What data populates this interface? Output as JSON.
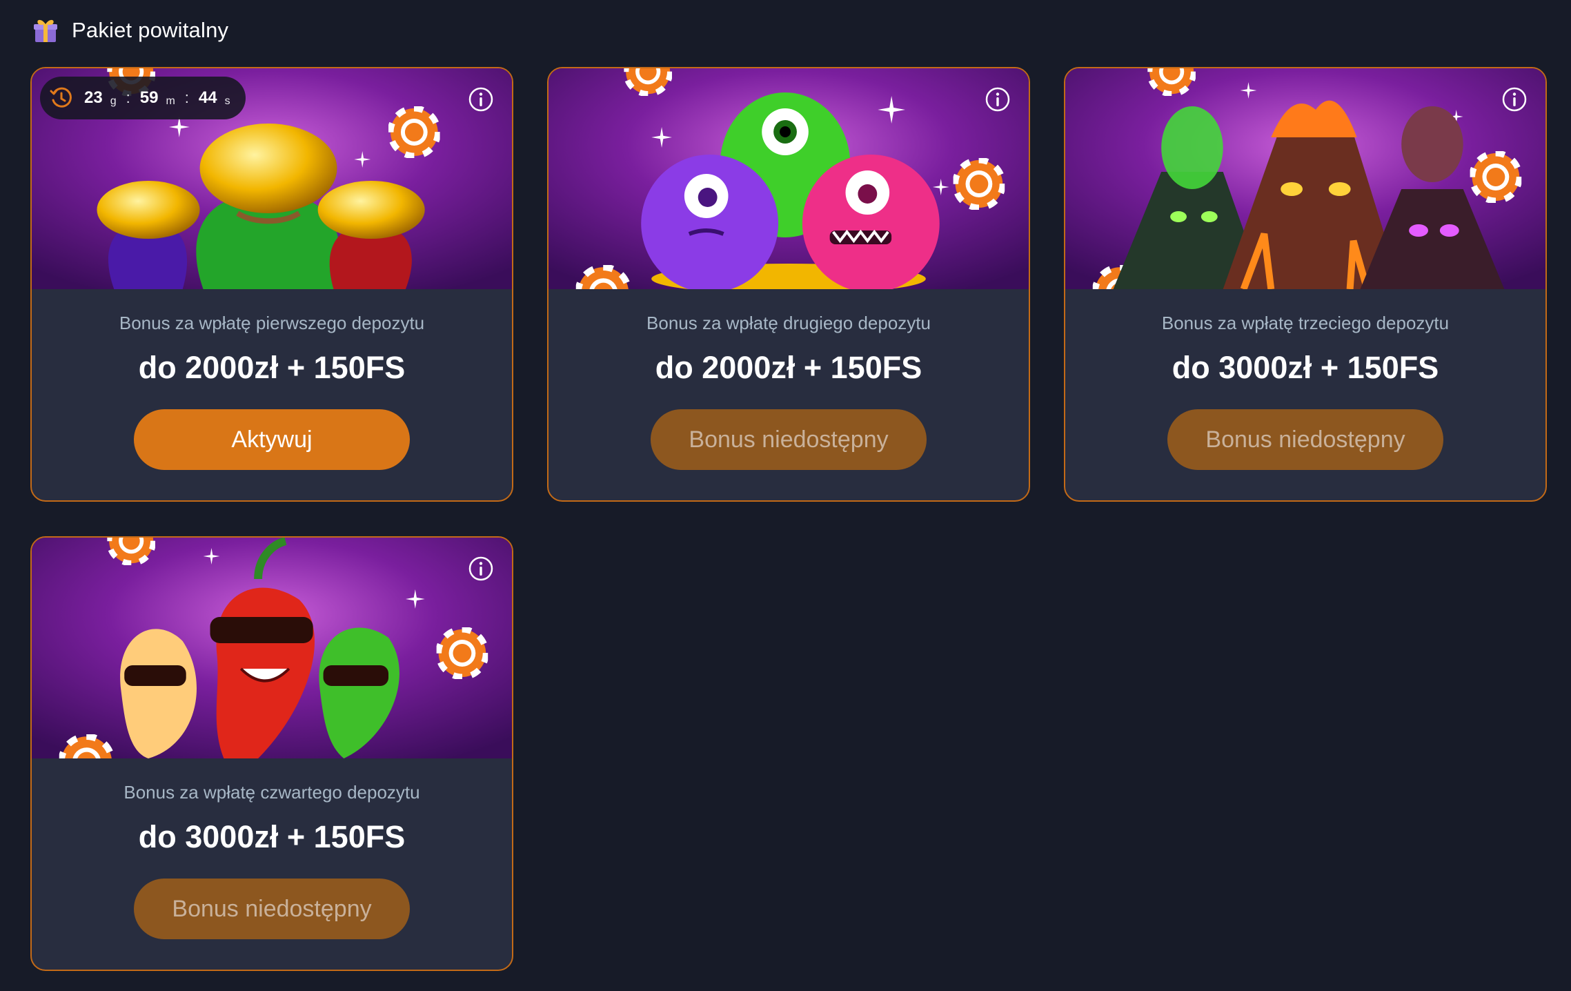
{
  "section": {
    "title": "Pakiet powitalny",
    "icon": "gift-icon"
  },
  "colors": {
    "background": "#171b28",
    "card": "#282d3f",
    "border": "#c36a17",
    "button_active": "#d97617",
    "button_disabled": "#8d571f",
    "subtitle": "#a7b7c6"
  },
  "timer": {
    "days": "23",
    "days_unit": "g",
    "hours": "59",
    "hours_unit": "m",
    "seconds": "44",
    "seconds_unit": "s",
    "separator": ":",
    "icon": "clock-icon"
  },
  "cards": [
    {
      "subtitle": "Bonus za wpłatę pierwszego depozytu",
      "amount": "do 2000zł + 150FS",
      "button": "Aktywuj",
      "button_state": "active",
      "image": "money-bags-image"
    },
    {
      "subtitle": "Bonus za wpłatę drugiego depozytu",
      "amount": "do 2000zł + 150FS",
      "button": "Bonus niedostępny",
      "button_state": "disabled",
      "image": "monsters-image"
    },
    {
      "subtitle": "Bonus za wpłatę trzeciego depozytu",
      "amount": "do 3000zł + 150FS",
      "button": "Bonus niedostępny",
      "button_state": "disabled",
      "image": "volcanoes-image"
    },
    {
      "subtitle": "Bonus za wpłatę czwartego depozytu",
      "amount": "do 3000zł + 150FS",
      "button": "Bonus niedostępny",
      "button_state": "disabled",
      "image": "chili-peppers-image"
    }
  ]
}
